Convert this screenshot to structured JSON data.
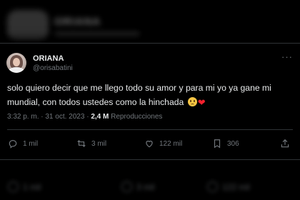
{
  "ghost_top": {
    "name": "ORIANA"
  },
  "tweet": {
    "display_name": "ORIANA",
    "handle": "@orisabatini",
    "more_label": "···",
    "text": "solo quiero decir que me llego todo su amor y para mi yo ya gane mi mundial, con todos ustedes como la hinchada",
    "emojis": [
      "pleading-face",
      "red-heart"
    ],
    "heart_glyph": "❤",
    "time": "3:32 p. m.",
    "separator": "·",
    "date": "31 oct. 2023",
    "views_count": "2,4 M",
    "views_label": "Reproducciones"
  },
  "actions": {
    "reply": {
      "icon": "reply-icon",
      "count": "1 mil"
    },
    "retweet": {
      "icon": "retweet-icon",
      "count": "3 mil"
    },
    "like": {
      "icon": "heart-icon",
      "count": "122 mil"
    },
    "bookmark": {
      "icon": "bookmark-icon",
      "count": "306"
    },
    "share": {
      "icon": "share-icon"
    }
  },
  "ghost_bottom": {
    "reply_count": "1 mil",
    "retweet_count": "3 mil",
    "like_count": "122 mil"
  },
  "colors": {
    "background": "#000000",
    "text": "#e7e9ea",
    "muted": "#71767b",
    "border": "#2f3336",
    "heart": "#f4212e"
  }
}
